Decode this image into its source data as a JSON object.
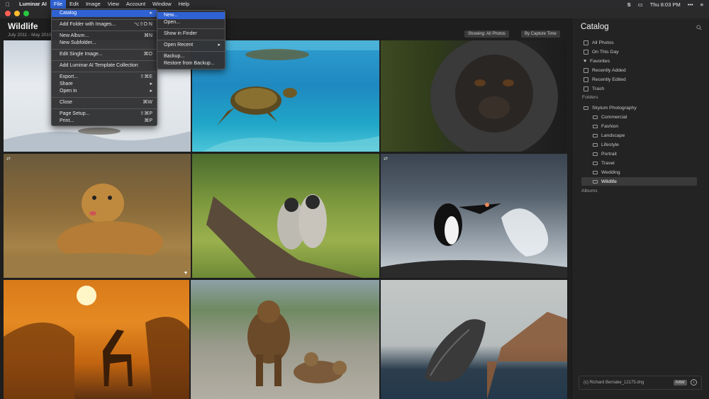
{
  "menubar": {
    "apple": "",
    "app_name": "Luminar AI",
    "menus": [
      "File",
      "Edit",
      "Image",
      "View",
      "Account",
      "Window",
      "Help"
    ],
    "clock": "Thu 8:03 PM"
  },
  "colors": {
    "accent": "#2f62d3",
    "close": "#fe5f57",
    "minimize": "#febc2e",
    "zoom": "#28c840"
  },
  "header": {
    "title": "Wildlife",
    "subtitle": "July 2011 - May 2019",
    "showing": "Showing: All Photos",
    "sort": "By Capture Time"
  },
  "file_menu": {
    "items": [
      {
        "label": "Catalog",
        "shortcut": "▸"
      },
      {
        "label": "Add Folder with Images...",
        "shortcut": "⌥⇧O N"
      },
      {
        "label": "New Album...",
        "shortcut": "⌘N"
      },
      {
        "label": "New Subfolder...",
        "shortcut": ""
      },
      {
        "label": "Edit Single Image...",
        "shortcut": "⌘O"
      },
      {
        "label": "Add Luminar AI Template Collection",
        "shortcut": ""
      },
      {
        "label": "Export...",
        "shortcut": "⇧⌘E"
      },
      {
        "label": "Share",
        "shortcut": "▸"
      },
      {
        "label": "Open in",
        "shortcut": "▸"
      },
      {
        "label": "Close",
        "shortcut": "⌘W"
      },
      {
        "label": "Page Setup...",
        "shortcut": "⇧⌘P"
      },
      {
        "label": "Print...",
        "shortcut": "⌘P"
      }
    ]
  },
  "catalog_menu": {
    "items": [
      {
        "label": "New...",
        "shortcut": ""
      },
      {
        "label": "Open...",
        "shortcut": ""
      },
      {
        "label": "Show in Finder",
        "shortcut": ""
      },
      {
        "label": "Open Recent",
        "shortcut": "▸"
      },
      {
        "label": "Backup...",
        "shortcut": ""
      },
      {
        "label": "Restore from Backup...",
        "shortcut": ""
      }
    ]
  },
  "sidebar": {
    "title": "Catalog",
    "library": [
      "All Photos",
      "On This Day",
      "Favorites",
      "Recently Added",
      "Recently Edited",
      "Trash"
    ],
    "folders_heading": "Folders",
    "root_folder": "Skylum Photography",
    "folders": [
      "Commercial",
      "Fashion",
      "Landscape",
      "Lifestyle",
      "Portrait",
      "Travel",
      "Wedding",
      "Wildlife"
    ],
    "albums_heading": "Albums",
    "footer_file": "(c) Richard Bernabe_12175.dng",
    "footer_badge": "RAW",
    "footer_info": "i"
  },
  "photos": [
    {
      "subject": "snow landscape"
    },
    {
      "subject": "sea turtle"
    },
    {
      "subject": "gorilla"
    },
    {
      "subject": "cheetah"
    },
    {
      "subject": "langur monkeys"
    },
    {
      "subject": "penguin"
    },
    {
      "subject": "giraffe at sunset"
    },
    {
      "subject": "bears"
    },
    {
      "subject": "whale"
    }
  ]
}
